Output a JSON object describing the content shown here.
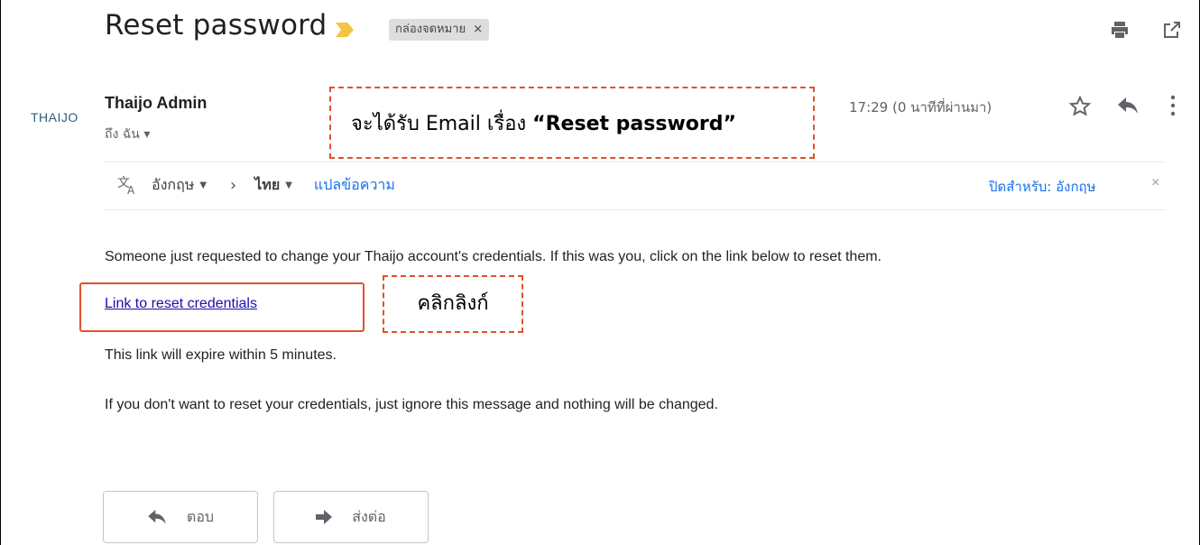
{
  "email": {
    "subject": "Reset password",
    "label_chip": "กล่องจดหมาย",
    "label_chip_close": "×",
    "sender_logo": "THAIJO",
    "sender_name": "Thaijo Admin",
    "to_line": "ถึง ฉัน ▾",
    "timestamp": "17:29 (0 นาทีที่ผ่านมา)"
  },
  "translate": {
    "from_lang": "อังกฤษ",
    "to_lang": "ไทย",
    "translate_link": "แปลข้อความ",
    "turn_off": "ปิดสำหรับ: อังกฤษ",
    "close": "×"
  },
  "body": {
    "line1": "Someone just requested to change your Thaijo account's credentials. If this was you, click on the link below to reset them.",
    "link": "Link to reset credentials",
    "line3": "This link will expire within 5 minutes.",
    "line4": "If you don't want to reset your credentials, just ignore this message and nothing will be changed."
  },
  "annotations": {
    "callout_prefix": "จะได้รับ Email เรื่อง ",
    "callout_quoted": "“Reset password”",
    "click_hint": "คลิกลิงก์"
  },
  "actions": {
    "reply": "ตอบ",
    "forward": "ส่งต่อ"
  },
  "colors": {
    "annotation": "#e0522f",
    "link": "#1a0dab",
    "accent": "#1a73e8",
    "important_marker": "#f4c542"
  }
}
